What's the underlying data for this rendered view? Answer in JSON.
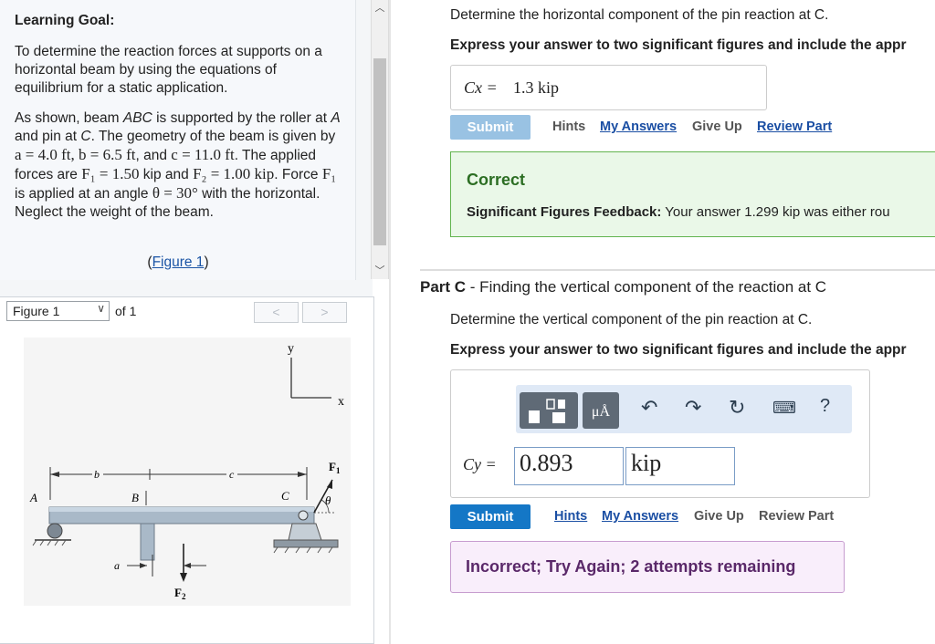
{
  "left": {
    "goal_title": "Learning Goal:",
    "goal_p1": "To determine the reaction forces at supports on a horizontal beam by using the equations of equilibrium for a static application.",
    "goal_p2_a": "As shown, beam ",
    "goal_p2_abc": "ABC",
    "goal_p2_b": " is supported by the roller at ",
    "goal_p2_A": "A",
    "goal_p2_c": " and pin at ",
    "goal_p2_C": "C",
    "goal_p2_d": ". The geometry of the beam is given by ",
    "goal_p2_vals1": "a = 4.0 ft, b = 6.5 ft",
    "goal_p2_and": ", and",
    "goal_p2_vals2": "c = 11.0 ft",
    "goal_p2_e": ". The applied forces are ",
    "goal_p2_F1": "F₁ = 1.50",
    "goal_p2_kip1": "kip",
    "goal_p2_and2": " and ",
    "goal_p2_F2": "F₂ = 1.00 kip",
    "goal_p2_f": ". Force ",
    "goal_p2_F1b": "F₁",
    "goal_p2_g": " is applied at an angle ",
    "goal_p2_theta": "θ = 30°",
    "goal_p2_h": " with the horizontal. Neglect the weight of the beam.",
    "figure_link_open": "(",
    "figure_link": "Figure 1",
    "figure_link_close": ")"
  },
  "figure": {
    "select_value": "Figure 1",
    "of_text": "of 1",
    "prev": "<",
    "next": ">",
    "labels": {
      "y": "y",
      "x": "x",
      "b": "b",
      "c": "c",
      "A": "A",
      "B": "B",
      "C": "C",
      "F1": "F",
      "F1_sub": "1",
      "F2": "F",
      "F2_sub": "2",
      "theta": "θ",
      "a": "a"
    }
  },
  "partB": {
    "question": "Determine the horizontal component of the pin reaction at C.",
    "instruction": "Express your answer to two significant figures and include the appr",
    "answer_label": "Cx =",
    "answer_value": "1.3 kip",
    "submit": "Submit",
    "hints": "Hints",
    "my_answers": "My Answers",
    "give_up": "Give Up",
    "review_part": "Review Part",
    "feedback_title": "Correct",
    "feedback_sigfig_label": "Significant Figures Feedback:",
    "feedback_sigfig_text": " Your answer 1.299 kip was either rou"
  },
  "partC": {
    "title_prefix": "Part C",
    "title_rest": " - Finding the vertical component of the reaction at C",
    "question": "Determine the vertical component of the pin reaction at C.",
    "instruction": "Express your answer to two significant figures and include the appr",
    "answer_label": "Cy =",
    "value_input": "0.893",
    "unit_input": "kip",
    "toolbar_unit": "μÅ",
    "toolbar_help": "?",
    "submit": "Submit",
    "hints": "Hints",
    "my_answers": "My Answers",
    "give_up": "Give Up",
    "review_part": "Review Part",
    "feedback": "Incorrect; Try Again; 2 attempts remaining"
  }
}
